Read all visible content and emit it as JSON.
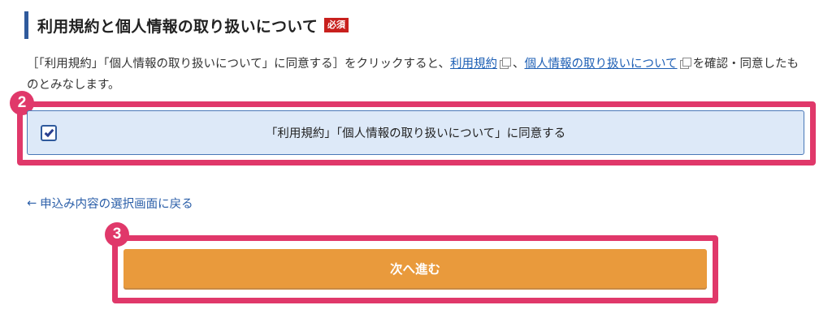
{
  "section": {
    "title": "利用規約と個人情報の取り扱いについて",
    "required_badge": "必須"
  },
  "description": {
    "part1": "［「利用規約」「個人情報の取り扱いについて」に同意する］をクリックすると、",
    "terms_link": "利用規約",
    "separator": "、",
    "privacy_link": "個人情報の取り扱いについて",
    "part2": "を確認・同意したものとみなします。"
  },
  "agreement": {
    "checked": true,
    "label": "「利用規約」「個人情報の取り扱いについて」に同意する"
  },
  "back_link": {
    "arrow": "←",
    "label": "申込み内容の選択画面に戻る"
  },
  "next_button": {
    "label": "次へ進む"
  },
  "steps": {
    "agree_step": "2",
    "next_step": "3"
  },
  "colors": {
    "accent_pink": "#e0386a",
    "button_orange": "#e99a3c",
    "required_red": "#c8201d",
    "heading_bar": "#2f5a9c",
    "link_blue": "#1d5fb5",
    "agree_bg": "#dde9f8"
  }
}
